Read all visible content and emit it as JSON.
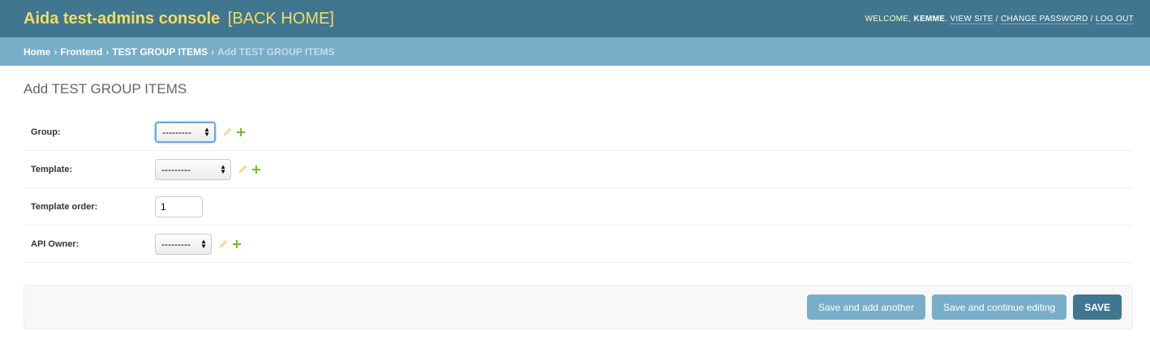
{
  "header": {
    "site_name": "Aida test-admins console",
    "back_home": "[BACK HOME]",
    "welcome": "WELCOME, ",
    "username": "KEMME",
    "view_site": "VIEW SITE",
    "change_password": "CHANGE PASSWORD",
    "log_out": "LOG OUT",
    "separator": " / "
  },
  "breadcrumbs": {
    "home": "Home",
    "app": "Frontend",
    "model": "TEST GROUP ITEMS",
    "current": "Add TEST GROUP ITEMS",
    "separator": "›"
  },
  "page_title": "Add TEST GROUP ITEMS",
  "form": {
    "group": {
      "label": "Group:",
      "value": "---------"
    },
    "template": {
      "label": "Template:",
      "value": "---------"
    },
    "template_order": {
      "label": "Template order:",
      "value": "1"
    },
    "api_owner": {
      "label": "API Owner:",
      "value": "---------"
    }
  },
  "buttons": {
    "save_add_another": "Save and add another",
    "save_continue": "Save and continue editing",
    "save": "SAVE"
  },
  "colors": {
    "header_bg": "#417690",
    "breadcrumb_bg": "#79aec8",
    "branding": "#f5dd5d",
    "add_icon": "#70bf2b",
    "edit_icon": "#efb80b"
  },
  "icons": [
    "pencil-icon",
    "plus-icon",
    "select-arrows-icon"
  ]
}
